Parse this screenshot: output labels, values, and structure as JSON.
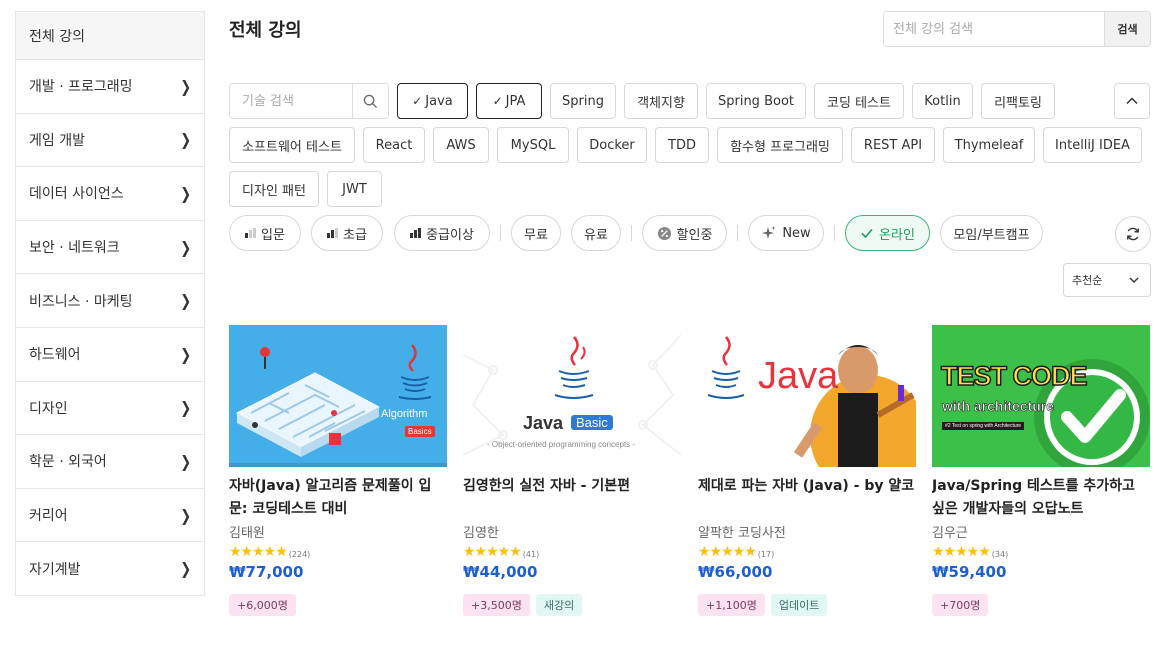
{
  "sidebar": {
    "items": [
      {
        "label": "전체 강의"
      },
      {
        "label": "개발 · 프로그래밍"
      },
      {
        "label": "게임 개발"
      },
      {
        "label": "데이터 사이언스"
      },
      {
        "label": "보안 · 네트워크"
      },
      {
        "label": "비즈니스 · 마케팅"
      },
      {
        "label": "하드웨어"
      },
      {
        "label": "디자인"
      },
      {
        "label": "학문 · 외국어"
      },
      {
        "label": "커리어"
      },
      {
        "label": "자기계발"
      }
    ]
  },
  "header": {
    "title": "전체 강의",
    "search_placeholder": "전체 강의 검색",
    "search_button": "검색"
  },
  "tags": {
    "search_placeholder": "기술 검색",
    "items": [
      {
        "label": "Java",
        "selected": true
      },
      {
        "label": "JPA",
        "selected": true
      },
      {
        "label": "Spring"
      },
      {
        "label": "객체지향"
      },
      {
        "label": "Spring Boot"
      },
      {
        "label": "코딩 테스트"
      },
      {
        "label": "Kotlin"
      },
      {
        "label": "리팩토링"
      },
      {
        "label": "소프트웨어 테스트"
      },
      {
        "label": "React"
      },
      {
        "label": "AWS"
      },
      {
        "label": "MySQL"
      },
      {
        "label": "Docker"
      },
      {
        "label": "TDD"
      },
      {
        "label": "함수형 프로그래밍"
      },
      {
        "label": "REST API"
      },
      {
        "label": "Thymeleaf"
      },
      {
        "label": "IntelliJ IDEA"
      },
      {
        "label": "디자인 패턴"
      },
      {
        "label": "JWT"
      }
    ]
  },
  "filters": {
    "level": [
      "입문",
      "초급",
      "중급이상"
    ],
    "price": [
      "무료",
      "유료"
    ],
    "discount": "할인중",
    "new": "New",
    "online": "온라인",
    "bootcamp": "모임/부트캠프",
    "sort": "추천순"
  },
  "courses": [
    {
      "title": "자바(Java) 알고리즘 문제풀이 입문: 코딩테스트 대비",
      "instructor": "김태원",
      "stars": "★★★★★",
      "rating_count": "(224)",
      "price": "₩77,000",
      "students": "+6,000명",
      "tag2": "",
      "thumb_text": "Algorithm",
      "thumb_badge": "Basics"
    },
    {
      "title": "김영한의 실전 자바 - 기본편",
      "instructor": "김영한",
      "stars": "★★★★★",
      "rating_count": "(41)",
      "price": "₩44,000",
      "students": "+3,500명",
      "tag2": "새강의",
      "thumb_text": "Java",
      "thumb_badge": "Basic",
      "thumb_sub": "- Object-oriented programming concepts -"
    },
    {
      "title": "제대로 파는 자바 (Java) - by 얄코",
      "instructor": "얄팍한 코딩사전",
      "stars": "★★★★★",
      "rating_count": "(17)",
      "price": "₩66,000",
      "students": "+1,100명",
      "tag2": "업데이트",
      "thumb_text": "Java"
    },
    {
      "title": "Java/Spring 테스트를 추가하고 싶은 개발자들의 오답노트",
      "instructor": "김우근",
      "stars": "★★★★★",
      "rating_count": "(34)",
      "price": "₩59,400",
      "students": "+700명",
      "tag2": "",
      "thumb_text": "TEST CODE",
      "thumb_text2": "with architecture",
      "thumb_small": "#2 Test on spring with Architecture"
    }
  ],
  "colors": {
    "price": "#1d5fd3",
    "star": "#fdbd11",
    "online_green": "#1e9e5c"
  }
}
